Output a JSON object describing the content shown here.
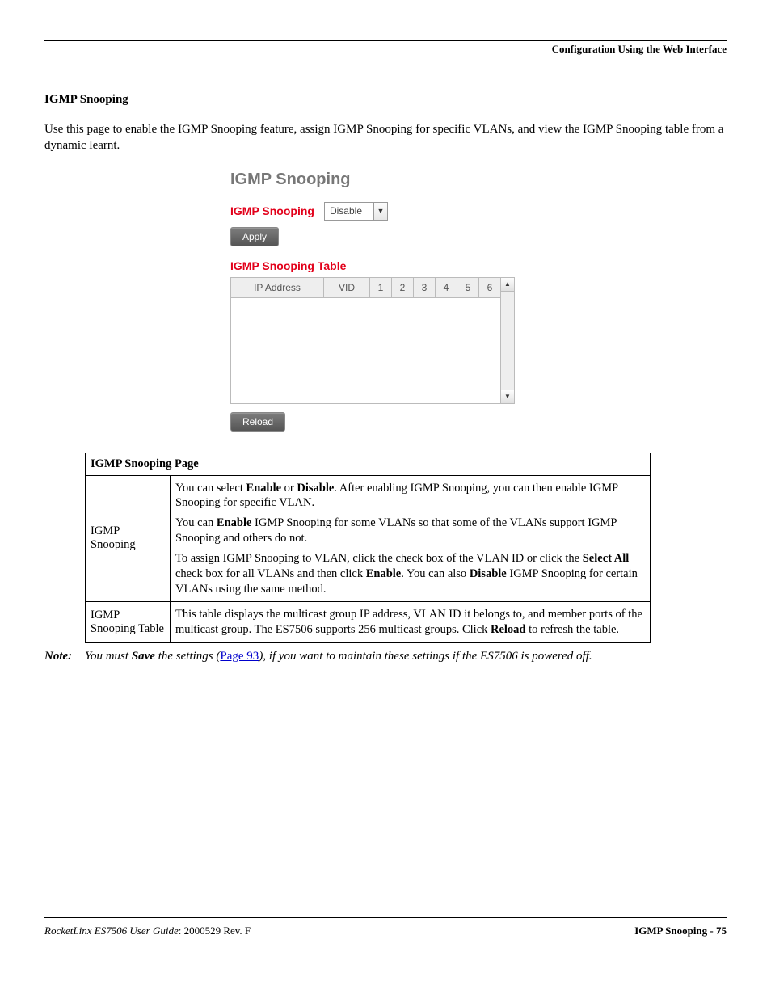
{
  "header": {
    "right": "Configuration Using the Web Interface"
  },
  "section": {
    "heading": "IGMP Snooping",
    "intro": "Use this page to enable the IGMP Snooping feature, assign IGMP Snooping for specific VLANs, and view the IGMP Snooping table from a dynamic learnt."
  },
  "screenshot": {
    "title": "IGMP Snooping",
    "setting_label": "IGMP Snooping",
    "setting_value": "Disable",
    "apply_label": "Apply",
    "table_heading": "IGMP Snooping Table",
    "columns": {
      "ip": "IP Address",
      "vid": "VID",
      "c1": "1",
      "c2": "2",
      "c3": "3",
      "c4": "4",
      "c5": "5",
      "c6": "6"
    },
    "reload_label": "Reload"
  },
  "doc_table": {
    "title": "IGMP Snooping Page",
    "rows": [
      {
        "label": "IGMP Snooping",
        "paras": [
          {
            "segments": [
              {
                "t": "You can select "
              },
              {
                "t": "Enable",
                "b": true
              },
              {
                "t": " or "
              },
              {
                "t": "Disable",
                "b": true
              },
              {
                "t": ". After enabling IGMP Snooping, you can then enable IGMP Snooping for specific VLAN."
              }
            ]
          },
          {
            "segments": [
              {
                "t": "You can "
              },
              {
                "t": "Enable",
                "b": true
              },
              {
                "t": " IGMP Snooping for some VLANs so that some of the VLANs support IGMP Snooping and others do not."
              }
            ]
          },
          {
            "segments": [
              {
                "t": "To assign IGMP Snooping to VLAN, click the check box of the VLAN ID or click the "
              },
              {
                "t": "Select All",
                "b": true
              },
              {
                "t": " check box for all VLANs and then click "
              },
              {
                "t": "Enable",
                "b": true
              },
              {
                "t": ". You can also "
              },
              {
                "t": "Disable",
                "b": true
              },
              {
                "t": " IGMP Snooping for certain VLANs using the same method."
              }
            ]
          }
        ]
      },
      {
        "label": "IGMP Snooping Table",
        "paras": [
          {
            "segments": [
              {
                "t": "This table displays the multicast group IP address, VLAN ID it belongs to, and member ports of the multicast group. The ES7506 supports 256 multicast groups. Click "
              },
              {
                "t": "Reload",
                "b": true
              },
              {
                "t": " to refresh the table."
              }
            ]
          }
        ]
      }
    ]
  },
  "note": {
    "label": "Note:",
    "pre": "You must ",
    "save": "Save",
    "mid1": " the settings (",
    "link": "Page 93",
    "mid2": "), if you want to maintain these settings if the ES7506 is powered off."
  },
  "footer": {
    "left_italic": "RocketLinx ES7506  User Guide",
    "left_plain": ": 2000529 Rev. F",
    "right": "IGMP Snooping - 75"
  }
}
